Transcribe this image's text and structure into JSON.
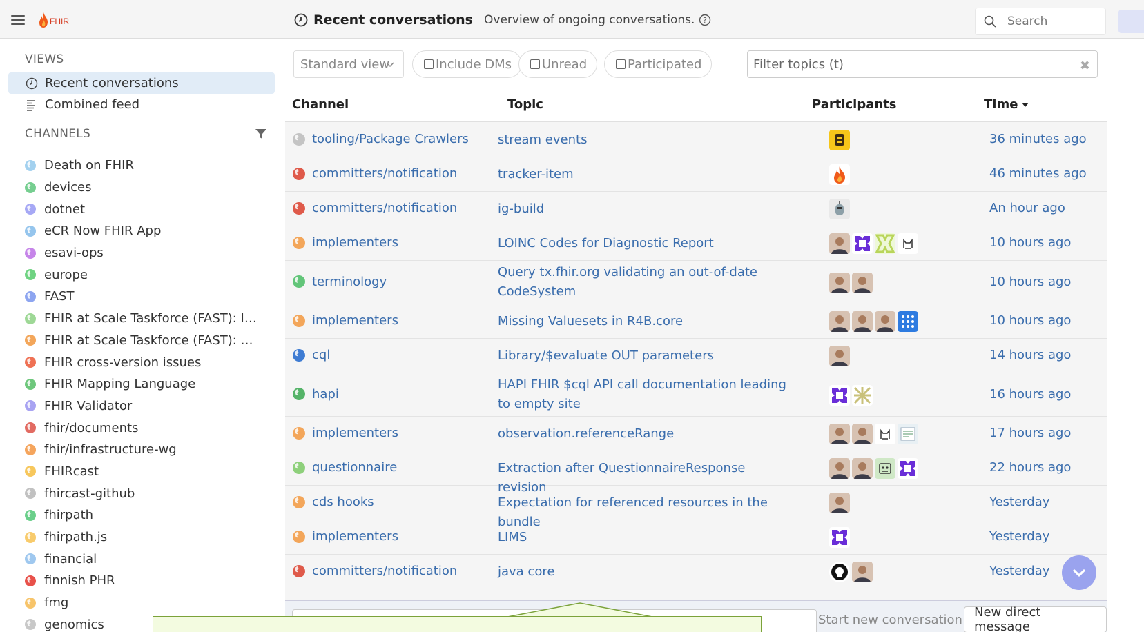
{
  "header": {
    "logo_text": "FHIR",
    "title": "Recent conversations",
    "description": "Overview of ongoing conversations.",
    "search_placeholder": "Search"
  },
  "sidebar": {
    "views_heading": "VIEWS",
    "views": [
      {
        "label": "Recent conversations",
        "icon": "clock-icon",
        "active": true
      },
      {
        "label": "Combined feed",
        "icon": "feed-icon",
        "active": false
      }
    ],
    "channels_heading": "CHANNELS",
    "channels": [
      {
        "label": "Death on FHIR",
        "color": "#a3d1ef"
      },
      {
        "label": "devices",
        "color": "#76ce90"
      },
      {
        "label": "dotnet",
        "color": "#a6a8f5"
      },
      {
        "label": "eCR Now FHIR App",
        "color": "#95c5ed"
      },
      {
        "label": "esavi-ops",
        "color": "#c685e9"
      },
      {
        "label": "europe",
        "color": "#6fd382"
      },
      {
        "label": "FAST",
        "color": "#8da5f0"
      },
      {
        "label": "FHIR at Scale Taskforce (FAST): I…",
        "color": "#9ed896"
      },
      {
        "label": "FHIR at Scale Taskforce (FAST): …",
        "color": "#f3a65a"
      },
      {
        "label": "FHIR cross-version issues",
        "color": "#ef7154"
      },
      {
        "label": "FHIR Mapping Language",
        "color": "#6ec77c"
      },
      {
        "label": "FHIR Validator",
        "color": "#a8a3f2"
      },
      {
        "label": "fhir/documents",
        "color": "#e26b62"
      },
      {
        "label": "fhir/infrastructure-wg",
        "color": "#f5a55d"
      },
      {
        "label": "FHIRcast",
        "color": "#f7c75c"
      },
      {
        "label": "fhircast-github",
        "color": "#c1c1c1"
      },
      {
        "label": "fhirpath",
        "color": "#6acf8a"
      },
      {
        "label": "fhirpath.js",
        "color": "#f8cb6c"
      },
      {
        "label": "financial",
        "color": "#9fc8ef"
      },
      {
        "label": "finnish PHR",
        "color": "#e8514a"
      },
      {
        "label": "fmg",
        "color": "#f7c46a"
      },
      {
        "label": "genomics",
        "color": "#c8c8c8"
      }
    ]
  },
  "filters": {
    "view_select": "Standard view",
    "include_dms": "Include DMs",
    "unread": "Unread",
    "participated": "Participated",
    "filter_placeholder": "Filter topics (t)"
  },
  "table": {
    "headers": {
      "channel": "Channel",
      "topic": "Topic",
      "participants": "Participants",
      "time": "Time"
    },
    "rows": [
      {
        "channel": "tooling/Package Crawlers",
        "color": "#c4c4c4",
        "topic": "stream events",
        "time": "36 minutes ago",
        "avatars": [
          "robot-avatar"
        ]
      },
      {
        "channel": "committers/notification",
        "color": "#df5a4a",
        "topic": "tracker-item",
        "time": "46 minutes ago",
        "avatars": [
          "fhir-flame-avatar"
        ]
      },
      {
        "channel": "committers/notification",
        "color": "#df5a4a",
        "topic": "ig-build",
        "time": "An hour ago",
        "avatars": [
          "bot-avatar"
        ]
      },
      {
        "channel": "implementers",
        "color": "#f3a65a",
        "topic": "LOINC Codes for Diagnostic Report",
        "time": "10 hours ago",
        "avatars": [
          "person-avatar",
          "purple-pattern-avatar",
          "green-pattern-avatar",
          "cat-avatar"
        ]
      },
      {
        "channel": "terminology",
        "color": "#62c579",
        "topic": "Query tx.fhir.org validating an out-of-date CodeSystem",
        "time": "10 hours ago",
        "avatars": [
          "person-avatar",
          "person-avatar"
        ]
      },
      {
        "channel": "implementers",
        "color": "#f3a65a",
        "topic": "Missing Valuesets in R4B.core",
        "time": "10 hours ago",
        "avatars": [
          "person-avatar",
          "person-avatar",
          "person-avatar",
          "blue-pattern-avatar"
        ]
      },
      {
        "channel": "cql",
        "color": "#3e7cd3",
        "topic": "Library/$evaluate OUT parameters",
        "time": "14 hours ago",
        "avatars": [
          "person-avatar"
        ]
      },
      {
        "channel": "hapi",
        "color": "#54b368",
        "topic": "HAPI FHIR $cql API call documentation leading to empty site",
        "time": "16 hours ago",
        "avatars": [
          "purple-pattern-avatar",
          "olive-pattern-avatar"
        ]
      },
      {
        "channel": "implementers",
        "color": "#f3a65a",
        "topic": "observation.referenceRange",
        "time": "17 hours ago",
        "avatars": [
          "person-avatar",
          "person-avatar",
          "cat-avatar",
          "document-avatar"
        ]
      },
      {
        "channel": "questionnaire",
        "color": "#8ed07b",
        "topic": "Extraction after QuestionnaireResponse revision",
        "time": "22 hours ago",
        "avatars": [
          "person-avatar",
          "person-avatar",
          "robot-green-avatar",
          "purple-pattern-avatar"
        ]
      },
      {
        "channel": "cds hooks",
        "color": "#f3a65a",
        "topic": "Expectation for referenced resources in the bundle",
        "time": "Yesterday",
        "avatars": [
          "person-avatar"
        ]
      },
      {
        "channel": "implementers",
        "color": "#f3a65a",
        "topic": "LIMS",
        "time": "Yesterday",
        "avatars": [
          "purple-pattern-avatar"
        ]
      },
      {
        "channel": "committers/notification",
        "color": "#df5a4a",
        "topic": "java core",
        "time": "Yesterday",
        "avatars": [
          "github-avatar",
          "person-avatar"
        ]
      }
    ]
  },
  "compose": {
    "start_conversation": "Start new conversation",
    "new_direct_message": "New direct message"
  }
}
